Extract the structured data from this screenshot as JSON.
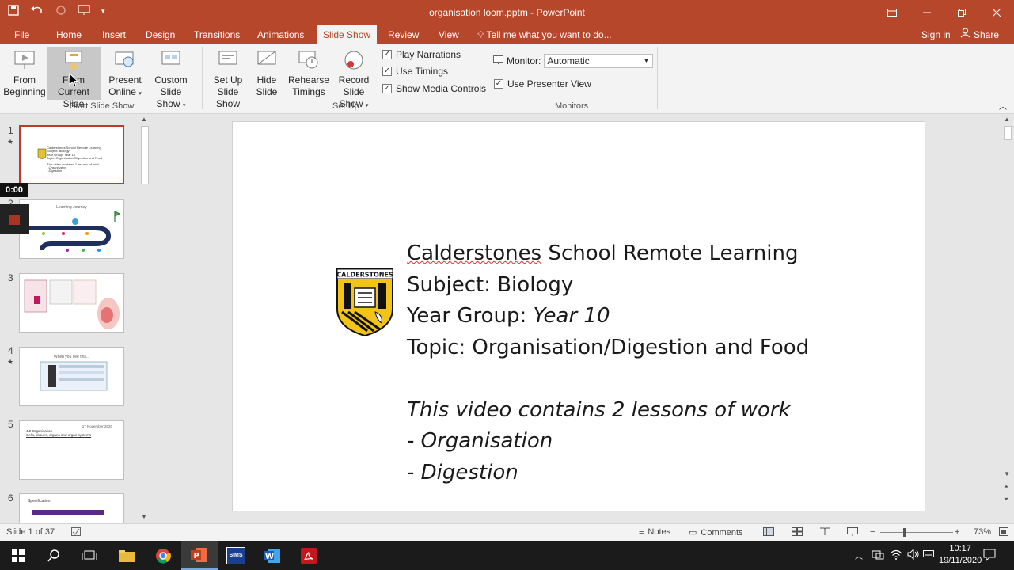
{
  "window": {
    "title": "organisation loom.pptm - PowerPoint"
  },
  "tabs": [
    {
      "label": "File"
    },
    {
      "label": "Home"
    },
    {
      "label": "Insert"
    },
    {
      "label": "Design"
    },
    {
      "label": "Transitions"
    },
    {
      "label": "Animations"
    },
    {
      "label": "Slide Show"
    },
    {
      "label": "Review"
    },
    {
      "label": "View"
    }
  ],
  "tellme": "Tell me what you want to do...",
  "account": {
    "signin": "Sign in",
    "share": "Share"
  },
  "ribbon": {
    "start_group": "Start Slide Show",
    "from_beginning": [
      "From",
      "Beginning"
    ],
    "from_current": [
      "From",
      "Current Slide"
    ],
    "present_online": [
      "Present",
      "Online"
    ],
    "custom_show": [
      "Custom Slide",
      "Show"
    ],
    "setup_group": "Set Up",
    "setup_show": [
      "Set Up",
      "Slide Show"
    ],
    "hide_slide": [
      "Hide",
      "Slide"
    ],
    "rehearse": [
      "Rehearse",
      "Timings"
    ],
    "record": [
      "Record Slide",
      "Show"
    ],
    "play_narrations": "Play Narrations",
    "use_timings": "Use Timings",
    "show_media": "Show Media Controls",
    "monitors_group": "Monitors",
    "monitor_label": "Monitor:",
    "monitor_value": "Automatic",
    "presenter_view": "Use Presenter View"
  },
  "thumbnails": {
    "numbers": [
      "1",
      "2",
      "3",
      "4",
      "5",
      "6"
    ],
    "t1_lines": [
      "Calderstones School Remote Learning",
      "Subject: Biology",
      "Year Group: Year 10",
      "Topic: Organisation/Digestion and Food",
      "This video contains 2 lessons of work",
      "- Organisation",
      "- Digestion"
    ],
    "t2_title": "Learning Journey",
    "t4_title": "When you see this...",
    "t5_date": "17 November 2020",
    "t5_title": "4.2 Organisation",
    "t5_sub": "Cells, tissues, organs and organ systems",
    "t6_title": "Specification"
  },
  "recorder": {
    "time": "0:00"
  },
  "slide": {
    "line1_a": "Calderstones",
    "line1_b": " School Remote Learning",
    "line2": "Subject: Biology",
    "line3_a": "Year Group: ",
    "line3_b": "Year  10",
    "line4": "Topic: Organisation/Digestion and Food",
    "line5": "This video contains 2 lessons of work",
    "line6": "- Organisation",
    "line7": "- Digestion",
    "crest_text": "CALDERSTONES"
  },
  "status": {
    "slide_of": "Slide 1 of 37",
    "notes": "Notes",
    "comments": "Comments",
    "zoom": "73%"
  },
  "taskbar": {
    "sims": "SIMS",
    "time": "10:17",
    "date": "19/11/2020"
  }
}
